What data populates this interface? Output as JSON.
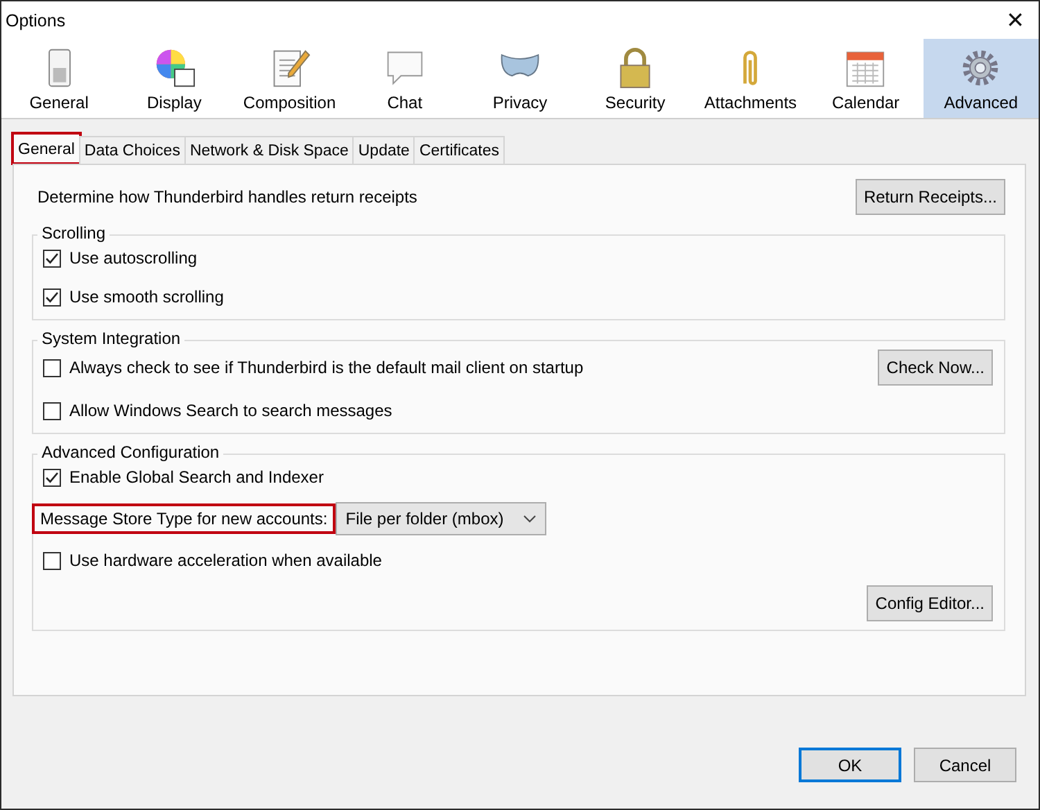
{
  "window": {
    "title": "Options",
    "close": "✕"
  },
  "toolbar": [
    {
      "label": "General",
      "selected": false
    },
    {
      "label": "Display",
      "selected": false
    },
    {
      "label": "Composition",
      "selected": false
    },
    {
      "label": "Chat",
      "selected": false
    },
    {
      "label": "Privacy",
      "selected": false
    },
    {
      "label": "Security",
      "selected": false
    },
    {
      "label": "Attachments",
      "selected": false
    },
    {
      "label": "Calendar",
      "selected": false
    },
    {
      "label": "Advanced",
      "selected": true
    }
  ],
  "subtabs": [
    {
      "label": "General",
      "selected": true,
      "highlighted": true
    },
    {
      "label": "Data Choices",
      "selected": false,
      "highlighted": false
    },
    {
      "label": "Network & Disk Space",
      "selected": false,
      "highlighted": false
    },
    {
      "label": "Update",
      "selected": false,
      "highlighted": false
    },
    {
      "label": "Certificates",
      "selected": false,
      "highlighted": false
    }
  ],
  "receipts": {
    "text": "Determine how Thunderbird handles return receipts",
    "button": "Return Receipts..."
  },
  "groups": [
    {
      "title": "Scrolling",
      "rows": [
        {
          "kind": "checkbox",
          "label": "Use autoscrolling",
          "checked": true
        },
        {
          "kind": "checkbox",
          "label": "Use smooth scrolling",
          "checked": true
        }
      ]
    },
    {
      "title": "System Integration",
      "rows": [
        {
          "kind": "checkbox",
          "label": "Always check to see if Thunderbird is the default mail client on startup",
          "checked": false,
          "button": "Check Now..."
        },
        {
          "kind": "checkbox",
          "label": "Allow Windows Search to search messages",
          "checked": false
        }
      ]
    },
    {
      "title": "Advanced Configuration",
      "rows": [
        {
          "kind": "checkbox",
          "label": "Enable Global Search and Indexer",
          "checked": true
        },
        {
          "kind": "select",
          "label": "Message Store Type for new accounts:",
          "value": "File per folder (mbox)",
          "highlighted": true
        },
        {
          "kind": "checkbox",
          "label": "Use hardware acceleration when available",
          "checked": false
        },
        {
          "kind": "button",
          "label": "Config Editor..."
        }
      ]
    }
  ],
  "buttons": [
    {
      "label": "OK",
      "default": true
    },
    {
      "label": "Cancel",
      "default": false
    }
  ]
}
